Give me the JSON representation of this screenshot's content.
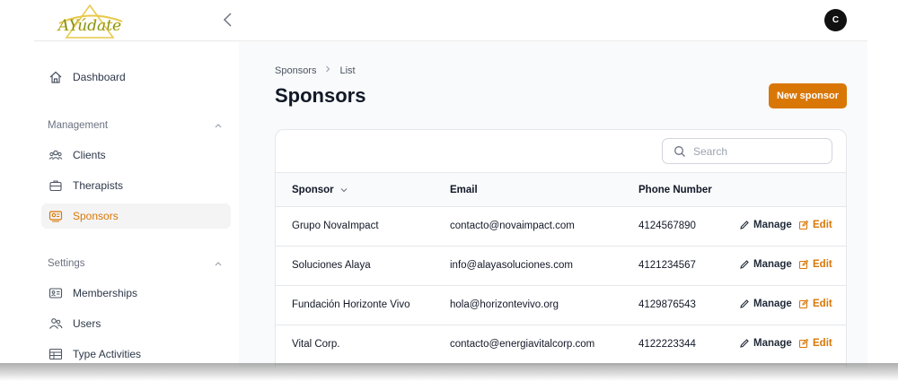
{
  "app": {
    "logo_text": "AYúdate",
    "user_initial": "C"
  },
  "sidebar": {
    "dashboard": {
      "label": "Dashboard",
      "icon": "home-icon"
    },
    "groups": [
      {
        "title": "Management",
        "items": [
          {
            "label": "Clients",
            "icon": "clients-icon"
          },
          {
            "label": "Therapists",
            "icon": "briefcase-icon"
          },
          {
            "label": "Sponsors",
            "icon": "sponsor-icon",
            "active": true
          }
        ]
      },
      {
        "title": "Settings",
        "items": [
          {
            "label": "Memberships",
            "icon": "id-card-icon"
          },
          {
            "label": "Users",
            "icon": "users-icon"
          },
          {
            "label": "Type Activities",
            "icon": "table-icon"
          }
        ]
      }
    ]
  },
  "main": {
    "breadcrumb": [
      "Sponsors",
      "List"
    ],
    "title": "Sponsors",
    "new_button": "New sponsor",
    "search_placeholder": "Search",
    "table": {
      "columns": [
        "Sponsor",
        "Email",
        "Phone Number"
      ],
      "actions": {
        "manage": "Manage",
        "edit": "Edit"
      },
      "rows": [
        {
          "sponsor": "Grupo NovaImpact",
          "email": "contacto@novaimpact.com",
          "phone": "4124567890"
        },
        {
          "sponsor": "Soluciones Alaya",
          "email": "info@alayasoluciones.com",
          "phone": "4121234567"
        },
        {
          "sponsor": "Fundación Horizonte Vivo",
          "email": "hola@horizontevivo.org",
          "phone": "4129876543"
        },
        {
          "sponsor": "Vital Corp.",
          "email": "contacto@energiavitalcorp.com",
          "phone": "4122223344"
        }
      ]
    }
  },
  "colors": {
    "accent": "#d97706",
    "active_bg": "#f4f4f5",
    "logo_green": "#6b8e23",
    "logo_yellow": "#e8c84a"
  }
}
